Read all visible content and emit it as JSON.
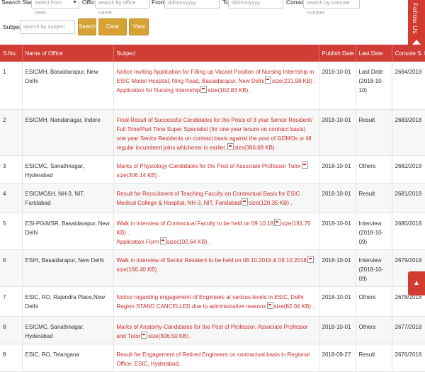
{
  "filters": {
    "search_states_label": "Search States:",
    "search_states_value": "Select from here.....",
    "office_label": "Office:",
    "office_placeholder": "search by office name",
    "from_label": "From:",
    "from_placeholder": "dd/mm/yyyy",
    "to_label": "To:",
    "to_placeholder": "dd/mm/yyyy",
    "console_label": "Console:",
    "console_placeholder": "search by console number",
    "subject_label": "Subject:",
    "subject_placeholder": "search by subject"
  },
  "buttons": {
    "search": "Search",
    "clear": "Clear Search",
    "view_all": "View All"
  },
  "table": {
    "headers": [
      "S.No.",
      "Name of Office",
      "Subject",
      "Publish Date",
      "Last Date",
      "Console S. No."
    ],
    "rows": [
      {
        "sno": "1",
        "office": "ESICMH, Basaidarapur, New Delhi",
        "subject_lines": [
          "Notice Inviting Application for Filling up Vacant Position of Nursing Internship in ESIC Model Hospital, Ring Road, Basaidarapur, New Delhi",
          "size(221.98 KB) .",
          "Application for Nursing Internship",
          "size(102.83 KB) ."
        ],
        "publish": "2018-10-01",
        "last": "Last Date (2018-10-10)",
        "console": "2684/2018"
      },
      {
        "sno": "2",
        "office": "ESICMH, Nandanagar, Indore",
        "subject_lines": [
          "Final Result of Successful Candidates for the Posts of 3 year Senior Resident/ Full Time/Part Time Super Specialist (for one year tenure on contract basis) one year Senior Residents on contract basis against the post of GDMOs or till regular incumbent joins whichever is earlier.",
          "size(366.68 KB) ."
        ],
        "publish": "2018-10-01",
        "last": "Result",
        "console": "2683/2018"
      },
      {
        "sno": "3",
        "office": "ESICMC, Sanathnagar, Hyderabad",
        "subject_lines": [
          "Marks of Physiology-Candidates for the Post of Associate Professor Tutor",
          "size(306.14 KB) ."
        ],
        "publish": "2018-10-01",
        "last": "Others",
        "console": "2682/2018"
      },
      {
        "sno": "4",
        "office": "ESICMC&H, NH-3, NIT, Faridabad",
        "subject_lines": [
          "Result for Recruitment of Teaching Faculty on Contractual Basis for ESIC Medical College & Hospital, NH-3, NIT, Faridabad",
          "size(120.35 KB) ."
        ],
        "publish": "2018-10-01",
        "last": "Result",
        "console": "2681/2018"
      },
      {
        "sno": "5",
        "office": "ESI-PGIMSR, Basaidarapur, New Delhi",
        "subject_lines": [
          "Walk in interview of Contractual Faculty to be held on 09.10.18",
          "size(181.76 KB) .",
          "Application Form",
          "size(102.64 KB) ."
        ],
        "publish": "2018-10-01",
        "last": "Interview (2018-10-09)",
        "console": "2680/2018"
      },
      {
        "sno": "6",
        "office": "ESIH, Basaidarapur, New Delhi",
        "subject_lines": [
          "Walk in interview of Senior Resident to be held on 08.10.2018 & 09.10.2018",
          "size(166.40 KB) ."
        ],
        "publish": "2018-10-01",
        "last": "Interview (2018-10-09)",
        "console": "2679/2018"
      },
      {
        "sno": "7",
        "office": "ESIC, RO, Rajendra Place,New Delhi",
        "subject_lines": [
          "Notice regarding engagement of Engineers at various levels in ESIC, Delhi Region STAND CANCELLED due to administrative reasons",
          "size(82.04 KB) ."
        ],
        "publish": "2018-10-01",
        "last": "Others",
        "console": "2678/2018"
      },
      {
        "sno": "8",
        "office": "ESICMC, Sanathnagar, Hyderabad",
        "subject_lines": [
          "Marks of Anatomy-Candidates for the Post of Professor, Associate Professor and Tutor",
          "size(306.50 KB) ."
        ],
        "publish": "2018-10-01",
        "last": "Others",
        "console": "2677/2018"
      },
      {
        "sno": "9",
        "office": "ESIC, RO, Telangana",
        "subject_lines": [
          "Result for Engagement of Retired Engineers on contractual basis in Regional Office, ESIC, Hyderabad,",
          ""
        ],
        "publish": "2018-09-27",
        "last": "Result",
        "console": "2676/2018"
      }
    ]
  },
  "side": {
    "follow": "Follow Us",
    "to_top": "▲"
  },
  "colors": {
    "header": "#cf3d34",
    "button": "#d6a236",
    "link": "#c9302c"
  }
}
